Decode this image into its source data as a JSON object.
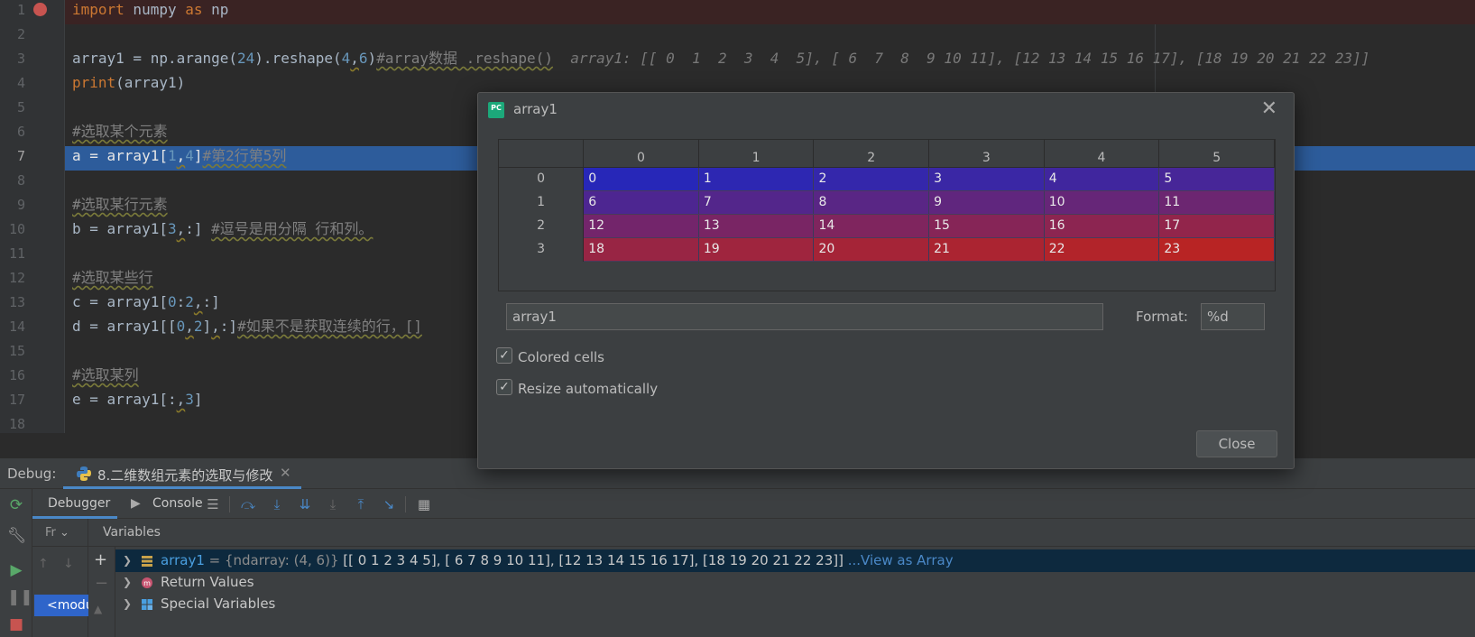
{
  "editor": {
    "line_numbers": [
      "1",
      "2",
      "3",
      "4",
      "5",
      "6",
      "7",
      "8",
      "9",
      "10",
      "11",
      "12",
      "13",
      "14",
      "15",
      "16",
      "17",
      "18"
    ],
    "inline_value": "array1: [[ 0  1  2  3  4  5], [ 6  7  8  9 10 11], [12 13 14 15 16 17], [18 19 20 21 22 23]]"
  },
  "debug": {
    "label": "Debug:",
    "session_tab": "8.二维数组元素的选取与修改",
    "tab_debugger": "Debugger",
    "tab_console": "Console",
    "frames_header": "Fr",
    "frame_item": "<module>",
    "variables_header": "Variables",
    "vars": [
      {
        "name": "array1",
        "type": " = {ndarray: (4, 6)} ",
        "value": "[[ 0  1  2  3  4  5], [ 6  7  8  9 10 11], [12 13 14 15 16 17], [18 19 20 21 22 23]]",
        "link": " ...View as Array"
      },
      {
        "name": "Return Values"
      },
      {
        "name": "Special Variables"
      }
    ]
  },
  "dialog": {
    "title": "array1",
    "columns": [
      "0",
      "1",
      "2",
      "3",
      "4",
      "5"
    ],
    "rows": [
      {
        "label": "0",
        "values": [
          "0",
          "1",
          "2",
          "3",
          "4",
          "5"
        ]
      },
      {
        "label": "1",
        "values": [
          "6",
          "7",
          "8",
          "9",
          "10",
          "11"
        ]
      },
      {
        "label": "2",
        "values": [
          "12",
          "13",
          "14",
          "15",
          "16",
          "17"
        ]
      },
      {
        "label": "3",
        "values": [
          "18",
          "19",
          "20",
          "21",
          "22",
          "23"
        ]
      }
    ],
    "variable_field": "array1",
    "format_label": "Format:",
    "format_value": "%d",
    "colored_cells_label": "Colored cells",
    "resize_label": "Resize automatically",
    "close_label": "Close"
  },
  "colors": {
    "cell_low": "#2727b8",
    "cell_high": "#b82424",
    "selection": "#2d5c9b",
    "accent": "#4a88c7"
  }
}
